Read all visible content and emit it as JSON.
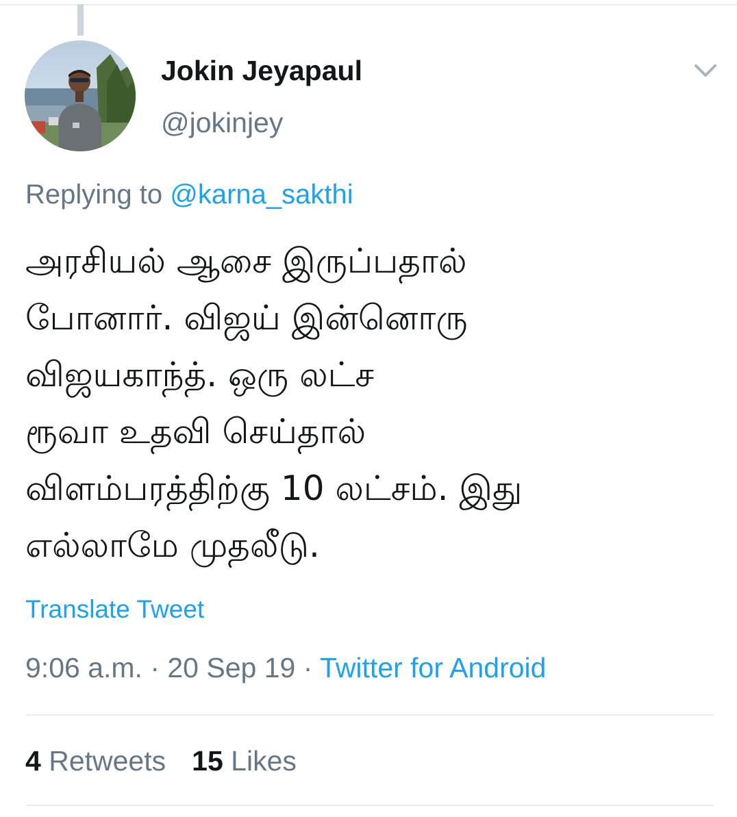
{
  "author": {
    "display_name": "Jokin Jeyapaul",
    "handle": "@jokinjey"
  },
  "reply": {
    "prefix": "Replying to ",
    "mention": "@karna_sakthi"
  },
  "tweet": {
    "text": "அரசியல் ஆசை இருப்பதால்\nபோனார். விஜய் இன்னொரு\nவிஜயகாந்த். ஒரு லட்ச\nரூவா உதவி செய்தால்\nவிளம்பரத்திற்கு 10 லட்சம். இது\nஎல்லாமே முதலீடு."
  },
  "translate_label": "Translate Tweet",
  "meta": {
    "time": "9:06 a.m.",
    "separator": " · ",
    "date": "20 Sep 19",
    "source": "Twitter for Android"
  },
  "stats": {
    "retweets_count": "4",
    "retweets_label": "Retweets",
    "likes_count": "15",
    "likes_label": "Likes"
  },
  "colors": {
    "accent": "#1da1f2",
    "text_primary": "#14171a",
    "text_secondary": "#657786",
    "divider": "#e6ecf0"
  },
  "icons": {
    "avatar": "profile-photo",
    "menu": "chevron-down-icon"
  }
}
